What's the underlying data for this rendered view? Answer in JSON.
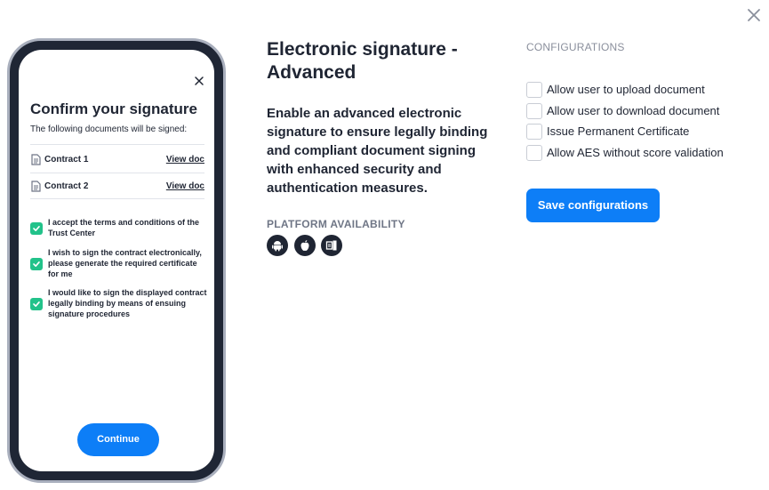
{
  "phone": {
    "title": "Confirm your signature",
    "subtitle": "The following documents will be signed:",
    "documents": [
      {
        "name": "Contract 1",
        "link": "View doc"
      },
      {
        "name": "Contract 2",
        "link": "View doc"
      }
    ],
    "consents": [
      {
        "text": "I accept the terms and conditions of the Trust Center",
        "checked": true
      },
      {
        "text": "I wish to sign the contract electronically, please generate the required certificate for me",
        "checked": true
      },
      {
        "text": "I would like to sign the displayed contract legally binding by means of ensuing signature procedures",
        "checked": true
      }
    ],
    "continue_label": "Continue"
  },
  "feature": {
    "title": "Electronic signature - Advanced",
    "description": "Enable an advanced electronic signature to ensure legally binding and compliant document signing with enhanced security and authentication measures.",
    "platform_label": "PLATFORM AVAILABILITY",
    "platform_icons": [
      "android-icon",
      "apple-icon",
      "windows-icon"
    ]
  },
  "configurations": {
    "label": "CONFIGURATIONS",
    "options": [
      {
        "label": "Allow user to upload document",
        "checked": false
      },
      {
        "label": "Allow user to download document",
        "checked": false
      },
      {
        "label": "Issue Permanent Certificate",
        "checked": false
      },
      {
        "label": "Allow AES without score validation",
        "checked": false
      }
    ],
    "save_label": "Save configurations"
  },
  "colors": {
    "primary": "#0d7ef7",
    "check": "#22c28a",
    "dark": "#1f2533",
    "muted": "#8a8f9c"
  }
}
